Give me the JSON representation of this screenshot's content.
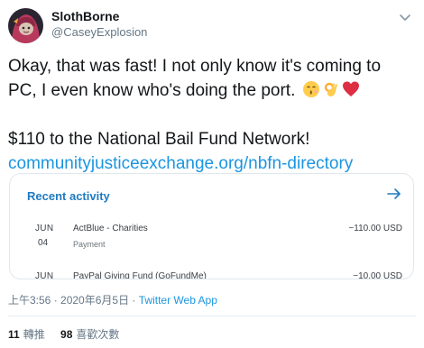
{
  "user": {
    "display_name": "SlothBorne",
    "handle": "@CaseyExplosion",
    "avatar_icon": "avatar-pink-hood"
  },
  "tweet": {
    "line1": "Okay, that was fast! I not only know it's coming to",
    "line2": "PC, I even know who's doing the port.",
    "emojis": [
      "kissing-face",
      "ok-hand",
      "red-heart"
    ],
    "line3": "$110 to the National Bail Fund Network!",
    "link": "communityjusticeexchange.org/nbfn-directory"
  },
  "card": {
    "title": "Recent activity",
    "arrow_icon": "arrow-right-icon",
    "rows": [
      {
        "month": "JUN",
        "day": "04",
        "merchant": "ActBlue - Charities",
        "kind": "Payment",
        "amount": "−110.00 USD"
      },
      {
        "month": "JUN",
        "day": "",
        "merchant": "PayPal Giving Fund (GoFundMe)",
        "kind": "",
        "amount": "−10.00 USD"
      }
    ]
  },
  "meta": {
    "timestamp": "上午3:56 · 2020年6月5日",
    "separator": " · ",
    "client": "Twitter Web App"
  },
  "stats": {
    "retweets_count": "11",
    "retweets_label": "轉推",
    "likes_count": "98",
    "likes_label": "喜歡次數"
  },
  "colors": {
    "link": "#1b95e0",
    "card_title": "#1f7bc1",
    "muted": "#657786"
  }
}
